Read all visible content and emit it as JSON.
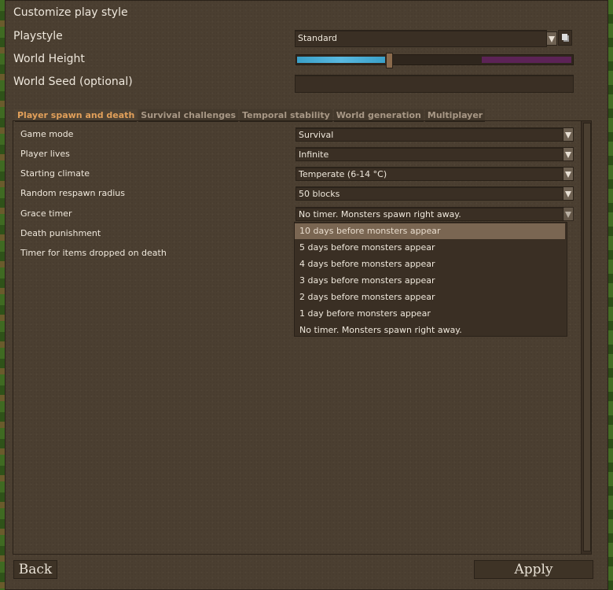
{
  "title": "Customize play style",
  "top_rows": [
    {
      "label": "Playstyle",
      "value": "Standard"
    },
    {
      "label": "World Height"
    },
    {
      "label": "World Seed (optional)",
      "value": ""
    }
  ],
  "world_height": {
    "fill_fraction": 0.33
  },
  "tabs": [
    {
      "label": "Player spawn and death",
      "active": true
    },
    {
      "label": "Survival challenges",
      "active": false
    },
    {
      "label": "Temporal stability",
      "active": false
    },
    {
      "label": "World generation",
      "active": false
    },
    {
      "label": "Multiplayer",
      "active": false
    }
  ],
  "settings": [
    {
      "label": "Game mode",
      "value": "Survival"
    },
    {
      "label": "Player lives",
      "value": "Infinite"
    },
    {
      "label": "Starting climate",
      "value": "Temperate (6-14 °C)"
    },
    {
      "label": "Random respawn radius",
      "value": "50 blocks"
    },
    {
      "label": "Grace timer",
      "value": "No timer. Monsters spawn right away."
    },
    {
      "label": "Death punishment"
    },
    {
      "label": "Timer for items dropped on death"
    }
  ],
  "grace_timer_options": [
    "10 days before monsters appear",
    "5 days before monsters appear",
    "4 days before monsters appear",
    "3 days before monsters appear",
    "2 days before monsters appear",
    "1 day before monsters appear",
    "No timer. Monsters spawn right away."
  ],
  "buttons": {
    "back": "Back",
    "apply": "Apply"
  },
  "icons": {
    "dropdown": "chevron-down-icon",
    "copy": "copy-icon"
  }
}
